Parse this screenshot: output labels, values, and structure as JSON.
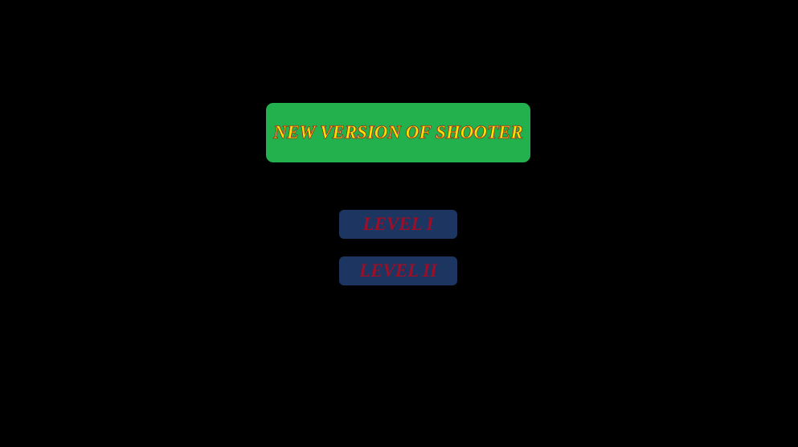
{
  "game": {
    "title": "NEW VERSION OF SHOOTER",
    "levels": [
      {
        "label": "LEVEL I"
      },
      {
        "label": "LEVEL II"
      }
    ]
  },
  "colors": {
    "background": "#000000",
    "title_banner": "#22b14c",
    "title_text": "#f5e600",
    "title_outline": "#b01020",
    "level_button": "#1c3561",
    "level_text": "#9b0f28"
  }
}
